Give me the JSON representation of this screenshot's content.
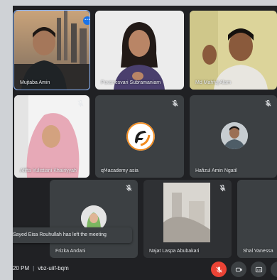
{
  "participants": [
    {
      "name": "Mujtaba Amin",
      "mic_muted": false
    },
    {
      "name": "Puvanesvari Subramaniam",
      "mic_muted": false
    },
    {
      "name": "Md Mahfuj Alam",
      "mic_muted": false
    },
    {
      "name": "Afiffa Yulistiani Khairiyyah",
      "mic_muted": true
    },
    {
      "name": "qf4academy asia",
      "mic_muted": true
    },
    {
      "name": "Hafizul Amin Ngatil",
      "mic_muted": true
    },
    {
      "name": "Frizka Andani",
      "mic_muted": true
    },
    {
      "name": "Najat Laspa Abubakari",
      "mic_muted": true
    },
    {
      "name": "Shal Vanessa",
      "mic_muted": false
    }
  ],
  "notification": {
    "text": "Sayed Eisa Rouhullah has left the meeting"
  },
  "bottom_bar": {
    "time": "20 PM",
    "meeting_code": "vbz-uiif-bqm"
  },
  "icons": [
    "mic-off-icon",
    "camera-icon",
    "captions-icon",
    "more-options-icon",
    "qf4academy-logo"
  ],
  "colors": {
    "background": "#202124",
    "tile": "#3c4043",
    "accent": "#1a73e8",
    "end_red": "#ea4335"
  }
}
